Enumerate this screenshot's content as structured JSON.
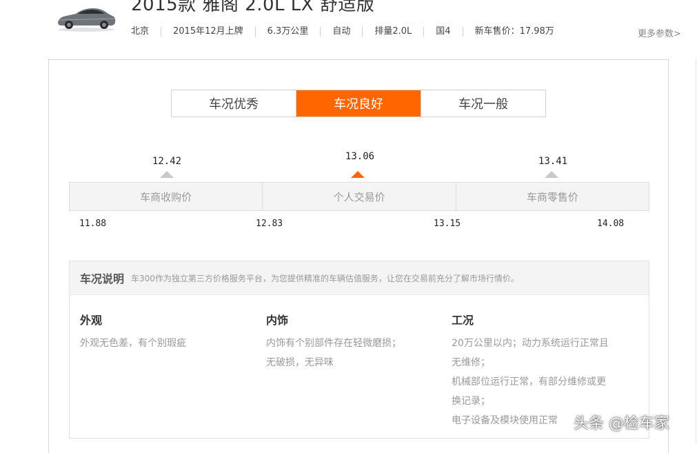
{
  "header": {
    "title": "2015款 雅阁 2.0L LX 舒适版",
    "specs": [
      "北京",
      "2015年12月上牌",
      "6.3万公里",
      "自动",
      "排量2.0L",
      "国4",
      "新车售价：17.98万"
    ],
    "more_params": "更多参数>"
  },
  "tabs": [
    {
      "label": "车况优秀",
      "active": false
    },
    {
      "label": "车况良好",
      "active": true
    },
    {
      "label": "车况一般",
      "active": false
    }
  ],
  "prices": {
    "dealer_buy": "12.42",
    "private_trade": "13.06",
    "dealer_retail": "13.41",
    "labels": [
      "车商收购价",
      "个人交易价",
      "车商零售价"
    ],
    "range": [
      "11.88",
      "12.83",
      "13.15",
      "14.08"
    ]
  },
  "condition": {
    "title": "车况说明",
    "description": "车300作为独立第三方价格服务平台，为您提供精准的车辆估值服务，让您在交易前充分了解市场行情价。",
    "columns": [
      {
        "title": "外观",
        "lines": [
          "外观无色差，有个别瑕疵"
        ]
      },
      {
        "title": "内饰",
        "lines": [
          "内饰有个别部件存在轻微磨损；",
          "无破损，无异味"
        ]
      },
      {
        "title": "工况",
        "lines": [
          "20万公里以内；动力系统运行正常且",
          "无维修；",
          "机械部位运行正常，有部分维修或更",
          "换记录；",
          "电子设备及模块使用正常"
        ]
      }
    ]
  },
  "watermark": "头条 @检车家",
  "colors": {
    "accent": "#ff6600",
    "bar_bg": "#f4f4f4",
    "muted_text": "#999999"
  }
}
